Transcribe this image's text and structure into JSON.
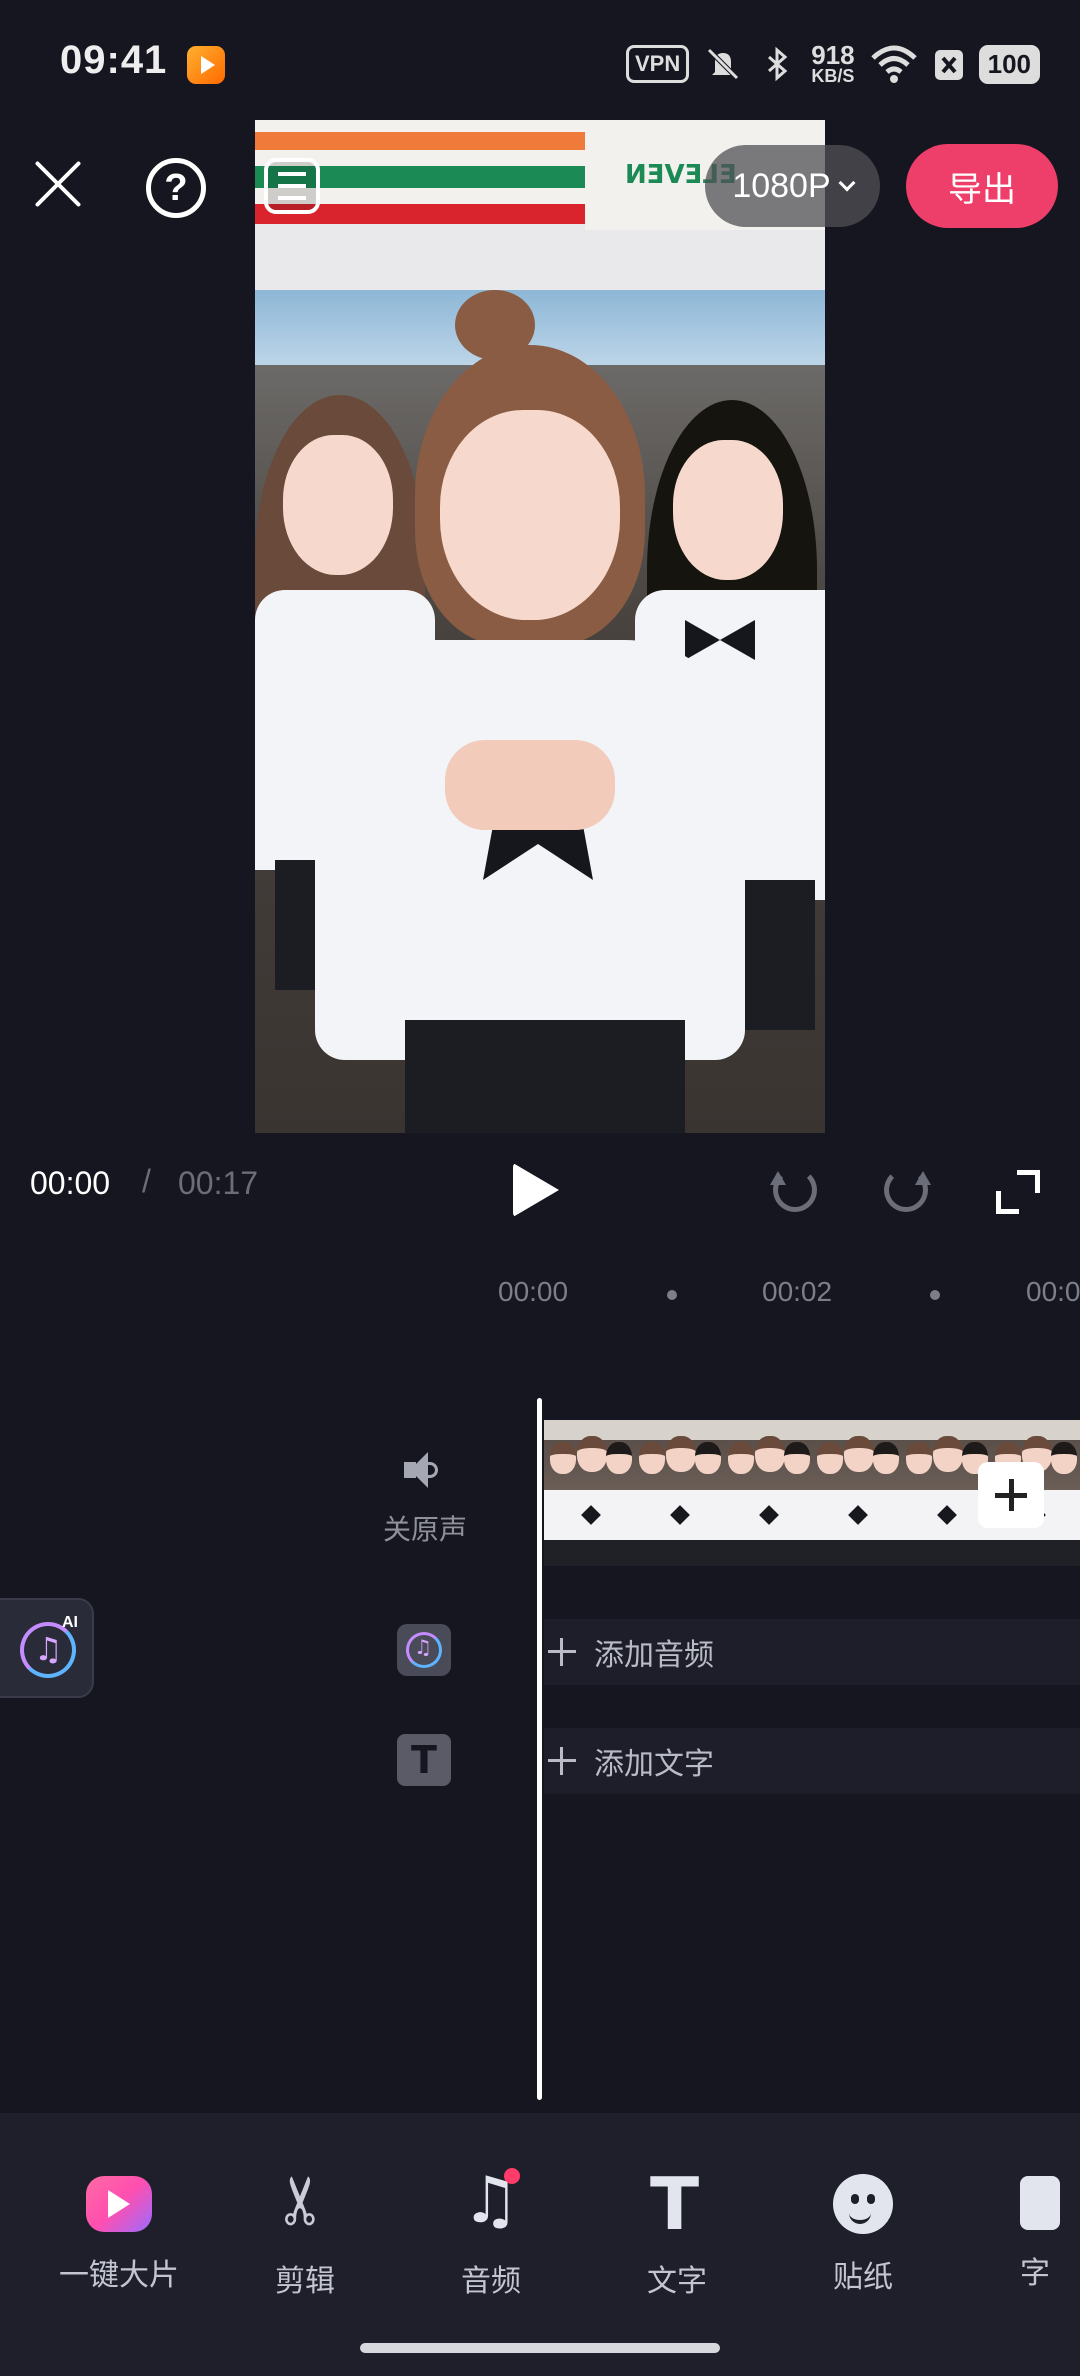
{
  "status_bar": {
    "time": "09:41",
    "vpn": "VPN",
    "net_rate_value": "918",
    "net_rate_unit": "KB/S",
    "battery": "100"
  },
  "editor": {
    "resolution": "1080P",
    "export_label": "导出"
  },
  "playback": {
    "current_time": "00:00",
    "separator": "/",
    "duration": "00:17"
  },
  "timeline": {
    "ticks": [
      "00:00",
      "00:02",
      "00:0"
    ],
    "mute_label": "关原声",
    "add_audio_label": "添加音频",
    "add_text_label": "添加文字",
    "ai_tag": "AI"
  },
  "toolbar": {
    "items": [
      {
        "label": "一键大片",
        "icon": "ai-movie-icon"
      },
      {
        "label": "剪辑",
        "icon": "scissors-icon"
      },
      {
        "label": "音频",
        "icon": "music-note-icon"
      },
      {
        "label": "文字",
        "icon": "text-icon"
      },
      {
        "label": "贴纸",
        "icon": "sticker-icon"
      },
      {
        "label": "字",
        "icon": "caption-icon"
      }
    ]
  },
  "colors": {
    "background": "#15161f",
    "accent": "#ee3f6a",
    "toolbar_bg": "#1e1f2b"
  }
}
